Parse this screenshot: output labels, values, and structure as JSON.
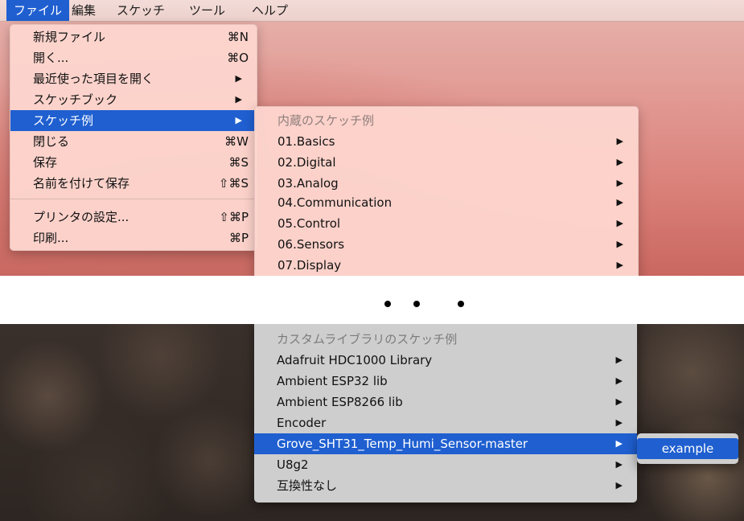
{
  "menubar": {
    "items": [
      "ファイル",
      "編集",
      "スケッチ",
      "ツール",
      "ヘルプ"
    ]
  },
  "file_menu": {
    "items": [
      {
        "label": "新規ファイル",
        "shortcut": "⌘N"
      },
      {
        "label": "開く...",
        "shortcut": "⌘O"
      },
      {
        "label": "最近使った項目を開く",
        "submenu": "▶"
      },
      {
        "label": "スケッチブック",
        "submenu": "▶"
      },
      {
        "label": "スケッチ例",
        "submenu": "▶"
      },
      {
        "label": "閉じる",
        "shortcut": "⌘W"
      },
      {
        "label": "保存",
        "shortcut": "⌘S"
      },
      {
        "label": "名前を付けて保存",
        "shortcut": "⇧⌘S"
      },
      {
        "label": "プリンタの設定...",
        "shortcut": "⇧⌘P"
      },
      {
        "label": "印刷...",
        "shortcut": "⌘P"
      }
    ]
  },
  "examples_menu": {
    "header": "内蔵のスケッチ例",
    "items": [
      {
        "label": "01.Basics",
        "submenu": "▶"
      },
      {
        "label": "02.Digital",
        "submenu": "▶"
      },
      {
        "label": "03.Analog",
        "submenu": "▶"
      },
      {
        "label": "04.Communication",
        "submenu": "▶"
      },
      {
        "label": "05.Control",
        "submenu": "▶"
      },
      {
        "label": "06.Sensors",
        "submenu": "▶"
      },
      {
        "label": "07.Display",
        "submenu": "▶"
      }
    ]
  },
  "custom_examples_menu": {
    "header": "カスタムライブラリのスケッチ例",
    "items": [
      {
        "label": "Adafruit HDC1000 Library",
        "submenu": "▶"
      },
      {
        "label": "Ambient ESP32 lib",
        "submenu": "▶"
      },
      {
        "label": "Ambient ESP8266 lib",
        "submenu": "▶"
      },
      {
        "label": "Encoder",
        "submenu": "▶"
      },
      {
        "label": "Grove_SHT31_Temp_Humi_Sensor-master",
        "submenu": "▶"
      },
      {
        "label": "U8g2",
        "submenu": "▶"
      },
      {
        "label": "互換性なし",
        "submenu": "▶"
      }
    ]
  },
  "library_submenu": {
    "items": [
      {
        "label": "example"
      }
    ]
  },
  "colors": {
    "highlight": "#1f5fd0",
    "light_menu_bg": "#fdd5ce",
    "dark_menu_bg": "#d4d4d4"
  }
}
